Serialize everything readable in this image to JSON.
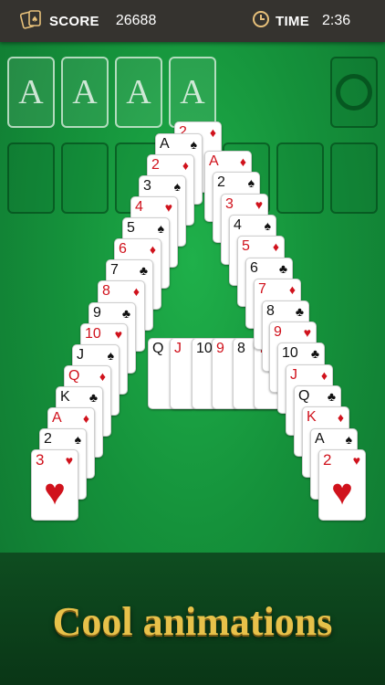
{
  "hud": {
    "score_label": "SCORE",
    "score_value": "26688",
    "time_label": "TIME",
    "time_value": "2:36"
  },
  "foundations": [
    "A",
    "A",
    "A",
    "A"
  ],
  "icons": {
    "score": "cards-icon",
    "time": "clock-icon",
    "stock": "recycle-ring-icon"
  },
  "colors": {
    "felt": "#15923b",
    "topbar": "#35332f",
    "red_suit": "#d0121c",
    "tagline_gold": "#e7c14a"
  },
  "left_leg": [
    {
      "rank": "A",
      "suit": "♠",
      "color": "black"
    },
    {
      "rank": "2",
      "suit": "♦",
      "color": "red"
    },
    {
      "rank": "3",
      "suit": "♠",
      "color": "black"
    },
    {
      "rank": "4",
      "suit": "♥",
      "color": "red"
    },
    {
      "rank": "5",
      "suit": "♠",
      "color": "black"
    },
    {
      "rank": "6",
      "suit": "♦",
      "color": "red"
    },
    {
      "rank": "7",
      "suit": "♣",
      "color": "black"
    },
    {
      "rank": "8",
      "suit": "♦",
      "color": "red"
    },
    {
      "rank": "9",
      "suit": "♣",
      "color": "black"
    },
    {
      "rank": "10",
      "suit": "♥",
      "color": "red"
    },
    {
      "rank": "J",
      "suit": "♠",
      "color": "black"
    },
    {
      "rank": "Q",
      "suit": "♦",
      "color": "red"
    },
    {
      "rank": "K",
      "suit": "♣",
      "color": "black"
    },
    {
      "rank": "A",
      "suit": "♦",
      "color": "red"
    },
    {
      "rank": "2",
      "suit": "♠",
      "color": "black"
    },
    {
      "rank": "3",
      "suit": "♥",
      "color": "red"
    }
  ],
  "right_leg": [
    {
      "rank": "A",
      "suit": "♦",
      "color": "red"
    },
    {
      "rank": "2",
      "suit": "♠",
      "color": "black"
    },
    {
      "rank": "3",
      "suit": "♥",
      "color": "red"
    },
    {
      "rank": "4",
      "suit": "♠",
      "color": "black"
    },
    {
      "rank": "5",
      "suit": "♦",
      "color": "red"
    },
    {
      "rank": "6",
      "suit": "♣",
      "color": "black"
    },
    {
      "rank": "7",
      "suit": "♦",
      "color": "red"
    },
    {
      "rank": "8",
      "suit": "♣",
      "color": "black"
    },
    {
      "rank": "9",
      "suit": "♥",
      "color": "red"
    },
    {
      "rank": "10",
      "suit": "♣",
      "color": "black"
    },
    {
      "rank": "J",
      "suit": "♦",
      "color": "red"
    },
    {
      "rank": "Q",
      "suit": "♣",
      "color": "black"
    },
    {
      "rank": "K",
      "suit": "♦",
      "color": "red"
    },
    {
      "rank": "A",
      "suit": "♠",
      "color": "black"
    },
    {
      "rank": "2",
      "suit": "♥",
      "color": "red"
    }
  ],
  "crossbar": [
    {
      "rank": "Q",
      "suit": "♠",
      "color": "black"
    },
    {
      "rank": "J",
      "suit": "♥",
      "color": "red"
    },
    {
      "rank": "10",
      "suit": "♠",
      "color": "black"
    },
    {
      "rank": "9",
      "suit": "♦",
      "color": "red"
    },
    {
      "rank": "8",
      "suit": "♠",
      "color": "black"
    },
    {
      "rank": "7",
      "suit": "♥",
      "color": "red"
    }
  ],
  "apex_card": {
    "rank": "2",
    "suit": "♦",
    "color": "red"
  },
  "tagline": "Cool animations"
}
